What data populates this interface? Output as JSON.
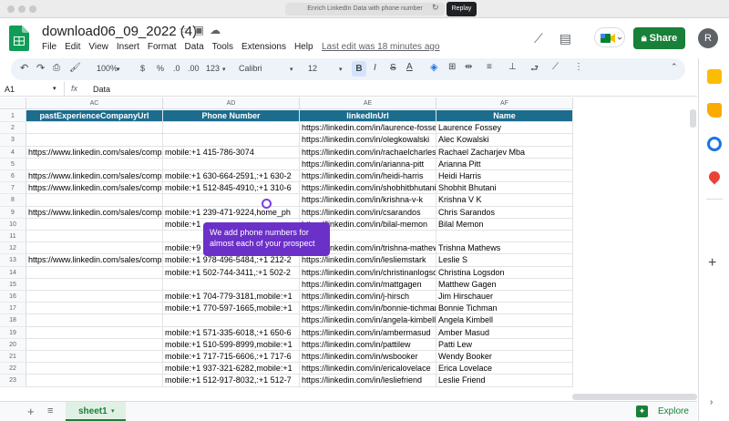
{
  "browser": {
    "url_text": "Enrich LinkedIn Data with phone number",
    "replay_label": "Replay"
  },
  "doc": {
    "title": "download06_09_2022 (4)",
    "last_edit": "Last edit was 18 minutes ago",
    "share_label": "Share",
    "avatar_letter": "R"
  },
  "menu": [
    "File",
    "Edit",
    "View",
    "Insert",
    "Format",
    "Data",
    "Tools",
    "Extensions",
    "Help"
  ],
  "toolbar": {
    "zoom": "100%",
    "currency": "$",
    "percent": "%",
    "dec_less": ".0",
    "dec_more": ".00",
    "number_format": "123",
    "font": "Calibri",
    "font_size": "12",
    "bold": "B",
    "italic": "I",
    "text_color": "A"
  },
  "formula_bar": {
    "cell_ref": "A1",
    "fx": "fx",
    "value": "Data"
  },
  "columns": [
    {
      "letter": "AC"
    },
    {
      "letter": "AD"
    },
    {
      "letter": "AE"
    },
    {
      "letter": "AF"
    }
  ],
  "header_row": [
    "pastExperienceCompanyUrl",
    "Phone Number",
    "linkedInUrl",
    "Name"
  ],
  "rows": [
    {
      "n": "1"
    },
    {
      "n": "2",
      "c": [
        "",
        "",
        "https://linkedin.com/in/laurence-fossey",
        "Laurence Fossey"
      ]
    },
    {
      "n": "3",
      "c": [
        "",
        "",
        "https://linkedin.com/in/olegkowalski",
        "Alec Kowalski"
      ]
    },
    {
      "n": "4",
      "c": [
        "https://www.linkedin.com/sales/company",
        "mobile:+1 415-786-3074",
        "https://linkedin.com/in/rachaelcharles",
        "Rachael Zacharjev Mba"
      ]
    },
    {
      "n": "5",
      "c": [
        "",
        "",
        "https://linkedin.com/in/arianna-pitt",
        "Arianna Pitt"
      ]
    },
    {
      "n": "6",
      "c": [
        "https://www.linkedin.com/sales/company",
        "mobile:+1 630-664-2591,:+1 630-2",
        "https://linkedin.com/in/heidi-harris",
        "Heidi Harris"
      ]
    },
    {
      "n": "7",
      "c": [
        "https://www.linkedin.com/sales/company",
        "mobile:+1 512-845-4910,:+1 310-6",
        "https://linkedin.com/in/shobhitbhutani",
        "Shobhit Bhutani"
      ]
    },
    {
      "n": "8",
      "c": [
        "",
        "",
        "https://linkedin.com/in/krishna-v-k",
        "Krishna V K"
      ]
    },
    {
      "n": "9",
      "c": [
        "https://www.linkedin.com/sales/company",
        "mobile:+1 239-471-9224,home_ph",
        "https://linkedin.com/in/csarandos",
        "Chris Sarandos"
      ]
    },
    {
      "n": "10",
      "c": [
        "",
        "mobile:+1",
        "https://linkedin.com/in/bilal-memon",
        "Bilal Memon"
      ]
    },
    {
      "n": "11",
      "c": [
        "",
        "",
        "",
        ""
      ]
    },
    {
      "n": "12",
      "c": [
        "",
        "mobile:+9",
        "https://linkedin.com/in/trishna-mathews",
        "Trishna Mathews"
      ]
    },
    {
      "n": "13",
      "c": [
        "https://www.linkedin.com/sales/company",
        "mobile:+1 978-496-5484,:+1 212-2",
        "https://linkedin.com/in/lesliemstark",
        "Leslie S"
      ]
    },
    {
      "n": "14",
      "c": [
        "",
        "mobile:+1 502-744-3411,:+1 502-2",
        "https://linkedin.com/in/christinanlogsdon",
        "Christina Logsdon"
      ]
    },
    {
      "n": "15",
      "c": [
        "",
        "",
        "https://linkedin.com/in/mattgagen",
        "Matthew Gagen"
      ]
    },
    {
      "n": "16",
      "c": [
        "",
        "mobile:+1 704-779-3181,mobile:+1",
        "https://linkedin.com/in/j-hirsch",
        "Jim Hirschauer"
      ]
    },
    {
      "n": "17",
      "c": [
        "",
        "mobile:+1 770-597-1665,mobile:+1",
        "https://linkedin.com/in/bonnie-tichman",
        "Bonnie Tichman"
      ]
    },
    {
      "n": "18",
      "c": [
        "",
        "",
        "https://linkedin.com/in/angela-kimbell",
        "Angela Kimbell"
      ]
    },
    {
      "n": "19",
      "c": [
        "",
        "mobile:+1 571-335-6018,:+1 650-6",
        "https://linkedin.com/in/ambermasud",
        "Amber Masud"
      ]
    },
    {
      "n": "20",
      "c": [
        "",
        "mobile:+1 510-599-8999,mobile:+1",
        "https://linkedin.com/in/pattilew",
        "Patti Lew"
      ]
    },
    {
      "n": "21",
      "c": [
        "",
        "mobile:+1 717-715-6606,:+1 717-6",
        "https://linkedin.com/in/wsbooker",
        "Wendy Booker"
      ]
    },
    {
      "n": "22",
      "c": [
        "",
        "mobile:+1 937-321-6282,mobile:+1",
        "https://linkedin.com/in/ericalovelace",
        "Erica Lovelace"
      ]
    },
    {
      "n": "23",
      "c": [
        "",
        "mobile:+1 512-917-8032,:+1 512-7",
        "https://linkedin.com/in/lesliefriend",
        "Leslie Friend"
      ]
    }
  ],
  "tooltip": {
    "text": "We add phone numbers for almost each of your prospect"
  },
  "bottom": {
    "add": "+",
    "list": "≡",
    "sheet_tab": "sheet1",
    "explore": "Explore"
  },
  "colors": {
    "header_fill": "#1c6c8e",
    "share_green": "#188038",
    "tooltip_purple": "#6b30c8"
  }
}
